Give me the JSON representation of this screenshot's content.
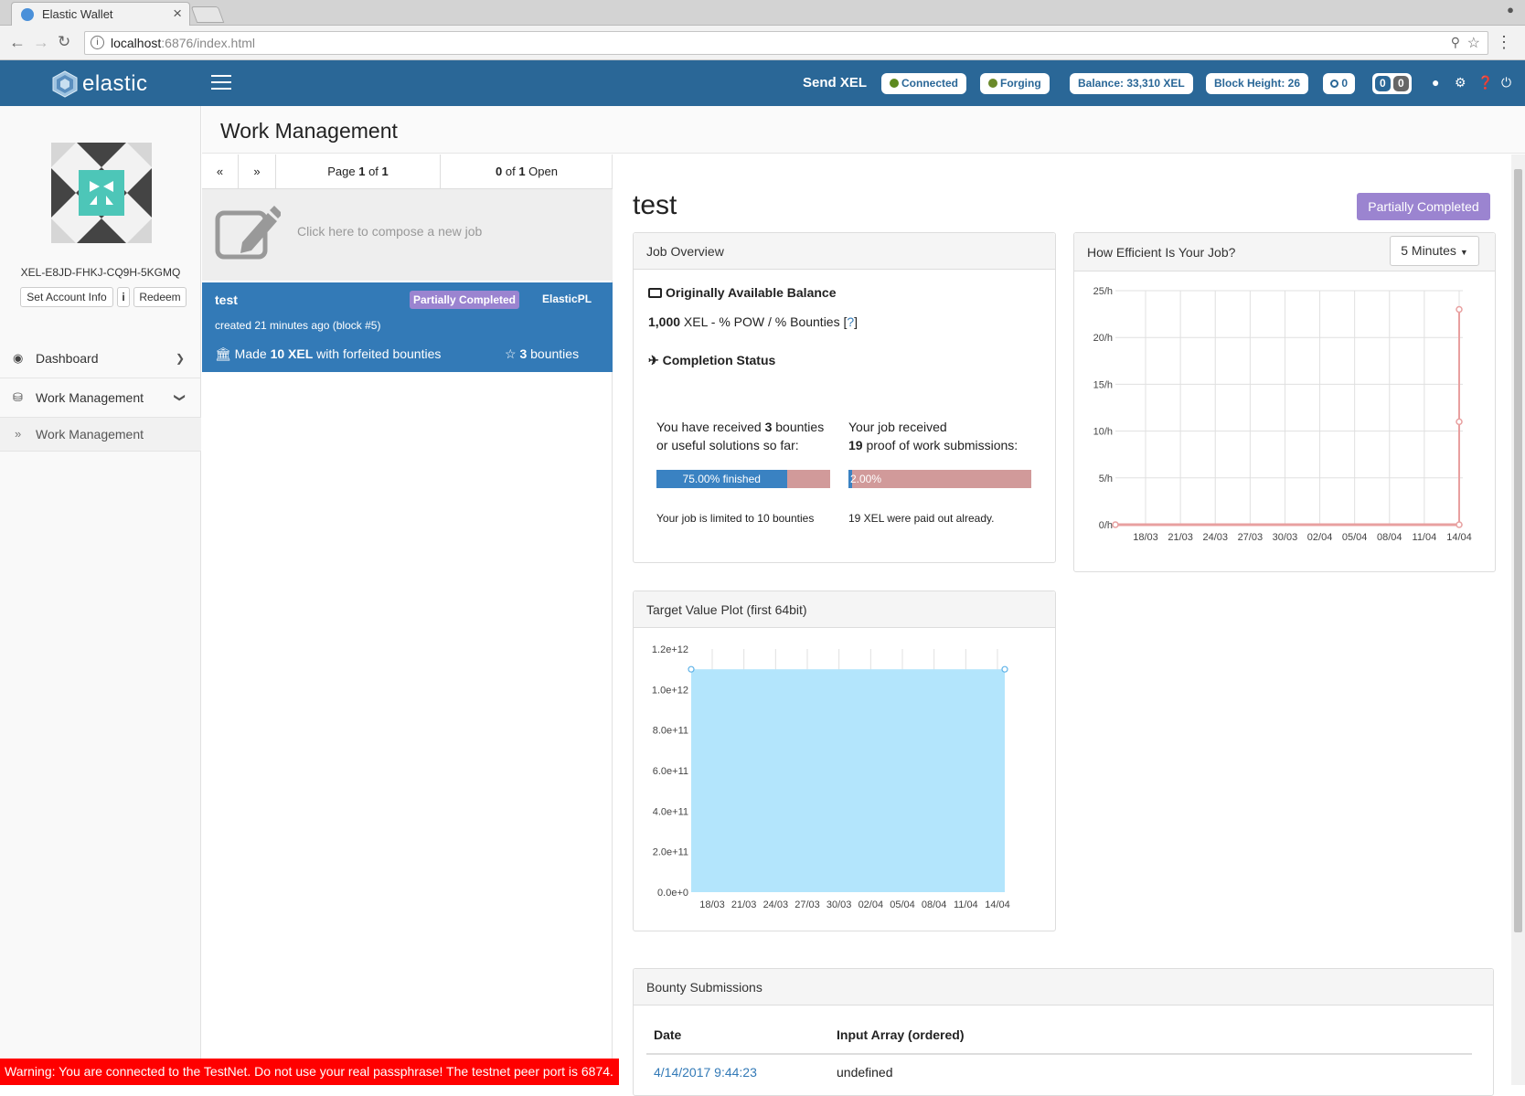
{
  "browser": {
    "tab_title": "Elastic Wallet",
    "url_host": "localhost",
    "url_rest": ":6876/index.html"
  },
  "header": {
    "logo_text": "elastic",
    "send_label": "Send XEL",
    "connected_label": "Connected",
    "forging_label": "Forging",
    "balance_label": "Balance: 33,310 XEL",
    "block_height_label": "Block Height: 26",
    "ring_count": "0",
    "badge_a": "0",
    "badge_b": "0",
    "connected_color": "#5d8a1f",
    "forging_color": "#6b8a2a"
  },
  "sidebar": {
    "account_id": "XEL-E8JD-FHKJ-CQ9H-5KGMQ",
    "set_account_info": "Set Account Info",
    "info_label": "i",
    "redeem_label": "Redeem",
    "nav": [
      {
        "label": "Dashboard"
      },
      {
        "label": "Work Management"
      },
      {
        "label": "Work Management"
      }
    ]
  },
  "page": {
    "title": "Work Management"
  },
  "joblist": {
    "prev": "«",
    "next": "»",
    "page_prefix": "Page ",
    "page_num": "1",
    "page_of": " of ",
    "page_total": "1",
    "open_num": "0",
    "open_of": " of ",
    "open_total": "1",
    "open_suffix": " Open",
    "compose_text": "Click here to compose a new job",
    "job": {
      "name": "test",
      "status": "Partially Completed",
      "language": "ElasticPL",
      "created": "created 21 minutes ago (block #5)",
      "made_prefix": "Made ",
      "made_amount": "10 XEL",
      "made_suffix": " with forfeited bounties",
      "bounties_num": "3",
      "bounties_suffix": " bounties"
    }
  },
  "detail": {
    "job_name": "test",
    "status_button": "Partially Completed",
    "overview": {
      "title": "Job Overview",
      "balance_heading": "Originally Available Balance",
      "balance_amount": "1,000",
      "balance_rest": " XEL - % POW / % Bounties [",
      "balance_q": "?",
      "balance_close": "]",
      "completion_heading": "Completion Status",
      "received_a1": "You have received ",
      "received_num": "3",
      "received_a2": " bounties",
      "received_b": "or useful solutions so far:",
      "pow_a": "Your job received",
      "pow_num": "19",
      "pow_b": " proof of work submissions:",
      "bounty_progress": 0.75,
      "bounty_progress_label": "75.00% finished",
      "pow_progress": 0.02,
      "pow_progress_label": "2.00%",
      "limit_text": "Your job is limited to 10 bounties",
      "paid_text": "19 XEL were paid out already."
    },
    "efficiency": {
      "title": "How Efficient Is Your Job?",
      "dropdown": "5 Minutes"
    },
    "target": {
      "title": "Target Value Plot (first 64bit)"
    },
    "bounty": {
      "title": "Bounty Submissions",
      "col_date": "Date",
      "col_input": "Input Array (ordered)",
      "rows": [
        {
          "date": "4/14/2017 9:44:23",
          "input": "undefined"
        }
      ]
    }
  },
  "chart_data": [
    {
      "type": "line",
      "x": [
        "18/03",
        "21/03",
        "24/03",
        "27/03",
        "30/03",
        "02/04",
        "05/04",
        "08/04",
        "11/04",
        "14/04"
      ],
      "yticks": [
        "0/h",
        "5/h",
        "10/h",
        "15/h",
        "20/h",
        "25/h"
      ],
      "ylim": [
        0,
        25
      ],
      "grid": true,
      "color": "#e8a0a0",
      "series": [
        {
          "values": [
            0,
            0,
            0,
            0,
            0,
            0,
            0,
            0,
            0,
            0
          ]
        },
        {
          "values": [
            null,
            null,
            null,
            null,
            null,
            null,
            null,
            null,
            null,
            23
          ]
        }
      ],
      "extra_points": [
        {
          "x": "14/04",
          "y": 11
        }
      ]
    },
    {
      "type": "area",
      "x": [
        "18/03",
        "21/03",
        "24/03",
        "27/03",
        "30/03",
        "02/04",
        "05/04",
        "08/04",
        "11/04",
        "14/04"
      ],
      "yticks": [
        "0.0e+0",
        "2.0e+11",
        "4.0e+11",
        "6.0e+11",
        "8.0e+11",
        "1.0e+12",
        "1.2e+12"
      ],
      "ylim": [
        0,
        1200000000000.0
      ],
      "color": "#b3e5fc",
      "series": [
        {
          "values": [
            1100000000000.0,
            1100000000000.0
          ]
        }
      ]
    }
  ],
  "warning": "Warning: You are connected to the TestNet. Do not use your real passphrase! The testnet peer port is 6874."
}
